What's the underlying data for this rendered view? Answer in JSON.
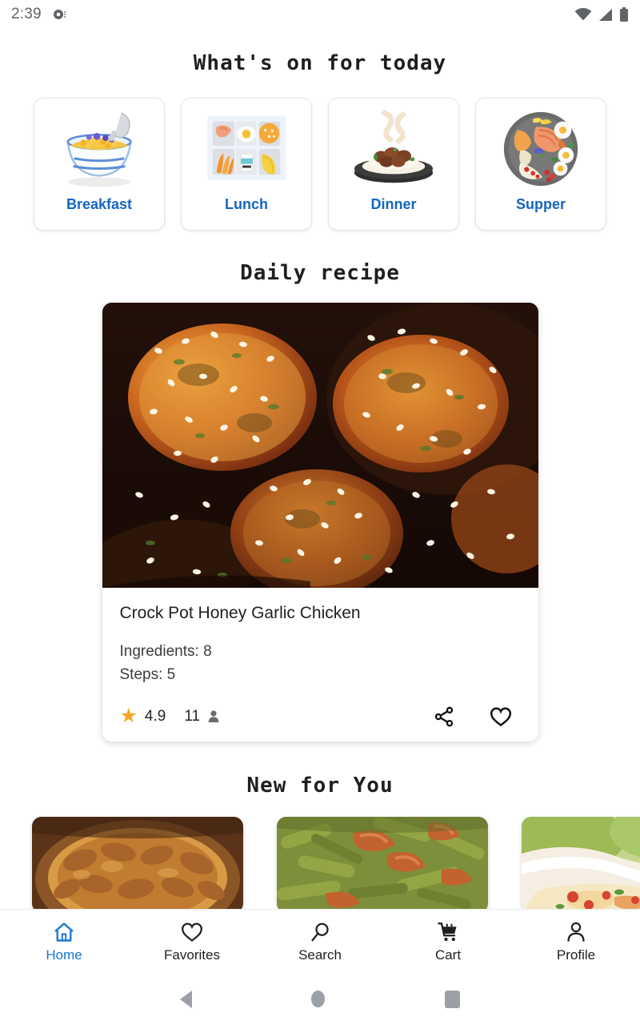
{
  "status_bar": {
    "time": "2:39",
    "notification_icon": "camera-notification-icon",
    "wifi_icon": "wifi-icon",
    "signal_icon": "cellular-signal-icon",
    "battery_icon": "battery-icon"
  },
  "sections": {
    "today_title": "What's on for today",
    "daily_title": "Daily recipe",
    "new_title": "New for You"
  },
  "categories": [
    {
      "label": "Breakfast",
      "icon": "cereal-bowl-icon"
    },
    {
      "label": "Lunch",
      "icon": "bento-box-icon"
    },
    {
      "label": "Dinner",
      "icon": "steaming-meat-plate-icon"
    },
    {
      "label": "Supper",
      "icon": "salmon-platter-icon"
    }
  ],
  "daily_recipe": {
    "image_alt": "crock-pot-honey-garlic-chicken-photo",
    "title": "Crock Pot Honey Garlic Chicken",
    "ingredients_label": "Ingredients: 8",
    "steps_label": "Steps: 5",
    "rating": "4.9",
    "rating_count": "11",
    "star_icon": "star-icon",
    "people_icon": "person-icon",
    "share_icon": "share-icon",
    "favorite_icon": "heart-outline-icon"
  },
  "new_for_you": [
    {
      "image_alt": "pecan-pie-photo"
    },
    {
      "image_alt": "green-beans-with-bacon-photo"
    },
    {
      "image_alt": "chicken-casserole-photo"
    }
  ],
  "bottom_nav": [
    {
      "label": "Home",
      "icon": "home-icon",
      "active": true
    },
    {
      "label": "Favorites",
      "icon": "heart-outline-icon",
      "active": false
    },
    {
      "label": "Search",
      "icon": "magnifier-icon",
      "active": false
    },
    {
      "label": "Cart",
      "icon": "shopping-cart-icon",
      "active": false
    },
    {
      "label": "Profile",
      "icon": "person-icon",
      "active": false
    }
  ],
  "system_nav": {
    "back": "back-triangle-icon",
    "home": "home-circle-icon",
    "recents": "recents-square-icon"
  },
  "colors": {
    "accent_blue": "#1565c0",
    "nav_active": "#1976d2",
    "star_orange": "#f5a623"
  }
}
